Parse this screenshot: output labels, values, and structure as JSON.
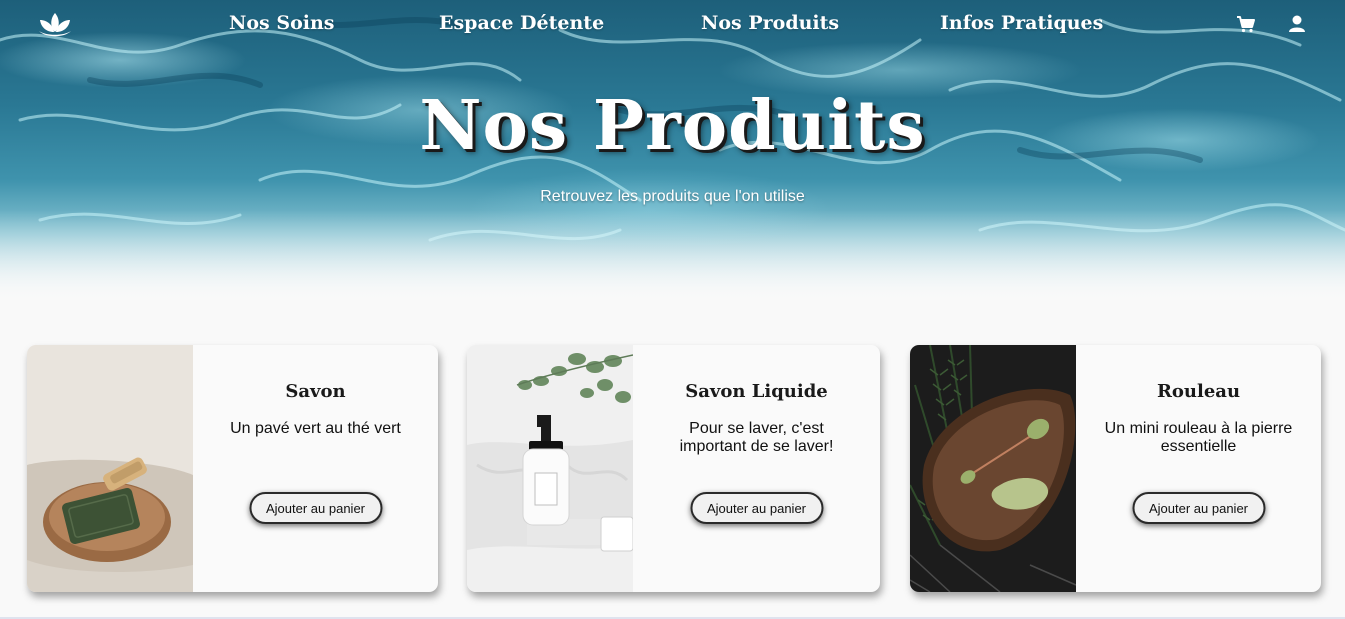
{
  "nav": {
    "links": [
      "Nos Soins",
      "Espace Détente",
      "Nos Produits",
      "Infos Pratiques"
    ],
    "logo_icon": "lotus-icon",
    "cart_icon": "cart-icon",
    "account_icon": "user-icon"
  },
  "hero": {
    "title": "Nos Produits",
    "subtitle": "Retrouvez les produits que l'on utilise"
  },
  "products": [
    {
      "name": "Savon",
      "description": "Un pavé vert au thé vert",
      "button": "Ajouter au panier",
      "image": "soap-bar-photo"
    },
    {
      "name": "Savon Liquide",
      "description": "Pour se laver, c'est important de se laver!",
      "button": "Ajouter au panier",
      "image": "liquid-soap-bottle-photo"
    },
    {
      "name": "Rouleau",
      "description": "Un mini rouleau à la pierre essentielle",
      "button": "Ajouter au panier",
      "image": "jade-roller-photo"
    }
  ],
  "colors": {
    "water_dark": "#1d5f7a",
    "water_light": "#86c3d2",
    "page_bg": "#f9f9f9",
    "button_bg": "#f1f1f1"
  }
}
